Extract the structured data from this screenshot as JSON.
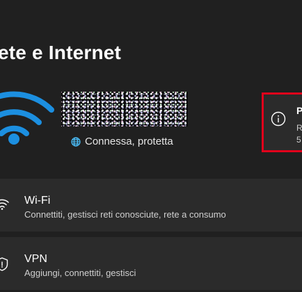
{
  "page": {
    "title": "ete e Internet"
  },
  "hero": {
    "network_name": "",
    "status": "Connessa, protetta",
    "status_icon": "globe-icon",
    "wifi_icon": "wifi-icon"
  },
  "properties": {
    "title": "P",
    "line1": "R",
    "line2": "5",
    "icon": "info-icon"
  },
  "rows": [
    {
      "title": "Wi-Fi",
      "subtitle": "Connettiti, gestisci reti conosciute, rete a consumo",
      "icon": "wifi-icon"
    },
    {
      "title": "VPN",
      "subtitle": "Aggiungi, connettiti, gestisci",
      "icon": "vpn-shield-icon"
    }
  ],
  "colors": {
    "background": "#202020",
    "card": "#2b2b2b",
    "accent": "#0078d4",
    "highlight_border": "#e1001b"
  }
}
